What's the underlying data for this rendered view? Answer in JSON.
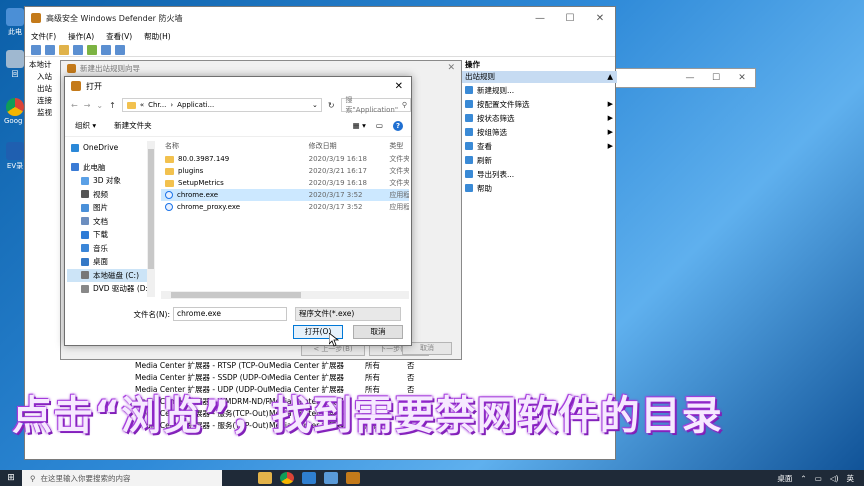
{
  "desktop": {
    "icons": [
      {
        "label": "此电"
      },
      {
        "label": "回"
      },
      {
        "label": "Goog Chro"
      },
      {
        "label": "EV录"
      }
    ]
  },
  "firewall": {
    "title": "高级安全 Windows Defender 防火墙",
    "menu": [
      "文件(F)",
      "操作(A)",
      "查看(V)",
      "帮助(H)"
    ],
    "tree": [
      "本地计",
      "入站",
      "出站",
      "连接",
      "监视"
    ],
    "actions_header": "操作",
    "actions_sub": "出站规则",
    "actions": [
      {
        "label": "新建规则...",
        "arrow": ""
      },
      {
        "label": "按配置文件筛选",
        "arrow": "▶"
      },
      {
        "label": "按状态筛选",
        "arrow": "▶"
      },
      {
        "label": "按组筛选",
        "arrow": "▶"
      },
      {
        "label": "查看",
        "arrow": "▶"
      },
      {
        "label": "刷新",
        "arrow": ""
      },
      {
        "label": "导出列表...",
        "arrow": ""
      },
      {
        "label": "帮助",
        "arrow": ""
      }
    ],
    "rules": [
      {
        "name": "Media Center 扩展器 - RTSP (TCP-Out)",
        "group": "Media Center 扩展器",
        "profile": "所有",
        "enabled": "否"
      },
      {
        "name": "Media Center 扩展器 - SSDP (UDP-Out)",
        "group": "Media Center 扩展器",
        "profile": "所有",
        "enabled": "否"
      },
      {
        "name": "Media Center 扩展器 - UDP (UDP-Out)",
        "group": "Media Center 扩展器",
        "profile": "所有",
        "enabled": "否"
      },
      {
        "name": "Media Center 扩展器 - WMDRM-ND/R...",
        "group": "Media Center 扩展器",
        "profile": "所有",
        "enabled": "否"
      },
      {
        "name": "Media Center 扩展器 - 服务(TCP-Out)",
        "group": "Media Center 扩展器",
        "profile": "所有",
        "enabled": "否"
      },
      {
        "name": "Media Center 扩展器 - 服务(TCP-Out)",
        "group": "Media Center 扩展器",
        "profile": "所有",
        "enabled": "否"
      }
    ]
  },
  "wizard": {
    "title": "新建出站规则向导",
    "back": "< 上一步(B)",
    "next": "下一步(N) >",
    "cancel": "取消"
  },
  "dialog": {
    "title": "打开",
    "path": [
      "Chr...",
      "Applicati..."
    ],
    "search_placeholder": "搜索\"Application\"",
    "organize": "组织 ▾",
    "new_folder": "新建文件夹",
    "nav": [
      {
        "label": "OneDrive",
        "color": "#2b88d8"
      },
      {
        "label": "此电脑",
        "color": "#3a7bd5"
      },
      {
        "label": "3D 对象",
        "color": "#5aa0e6"
      },
      {
        "label": "视频",
        "color": "#555555"
      },
      {
        "label": "图片",
        "color": "#4a90d9"
      },
      {
        "label": "文档",
        "color": "#6c8ebf"
      },
      {
        "label": "下载",
        "color": "#2e7bd6"
      },
      {
        "label": "音乐",
        "color": "#3b86d8"
      },
      {
        "label": "桌面",
        "color": "#3478c6"
      },
      {
        "label": "本地磁盘 (C:)",
        "color": "#777777"
      },
      {
        "label": "DVD 驱动器 (D:",
        "color": "#888888"
      }
    ],
    "columns": {
      "name": "名称",
      "date": "修改日期",
      "type": "类型"
    },
    "files": [
      {
        "name": "80.0.3987.149",
        "date": "2020/3/19 16:18",
        "type": "文件夹",
        "kind": "folder"
      },
      {
        "name": "plugins",
        "date": "2020/3/21 16:17",
        "type": "文件夹",
        "kind": "folder"
      },
      {
        "name": "SetupMetrics",
        "date": "2020/3/19 16:18",
        "type": "文件夹",
        "kind": "folder"
      },
      {
        "name": "chrome.exe",
        "date": "2020/3/17 3:52",
        "type": "应用程序",
        "kind": "exe"
      },
      {
        "name": "chrome_proxy.exe",
        "date": "2020/3/17 3:52",
        "type": "应用程序",
        "kind": "exe"
      }
    ],
    "filename_label": "文件名(N):",
    "filename_value": "chrome.exe",
    "filetype": "程序文件(*.exe)",
    "open": "打开(O)",
    "cancel": "取消"
  },
  "caption": "点击“浏览”，找到需要禁网软件的目录",
  "taskbar": {
    "search_placeholder": "在这里输入你要搜索的内容",
    "tray": [
      "桌面",
      "英"
    ]
  }
}
